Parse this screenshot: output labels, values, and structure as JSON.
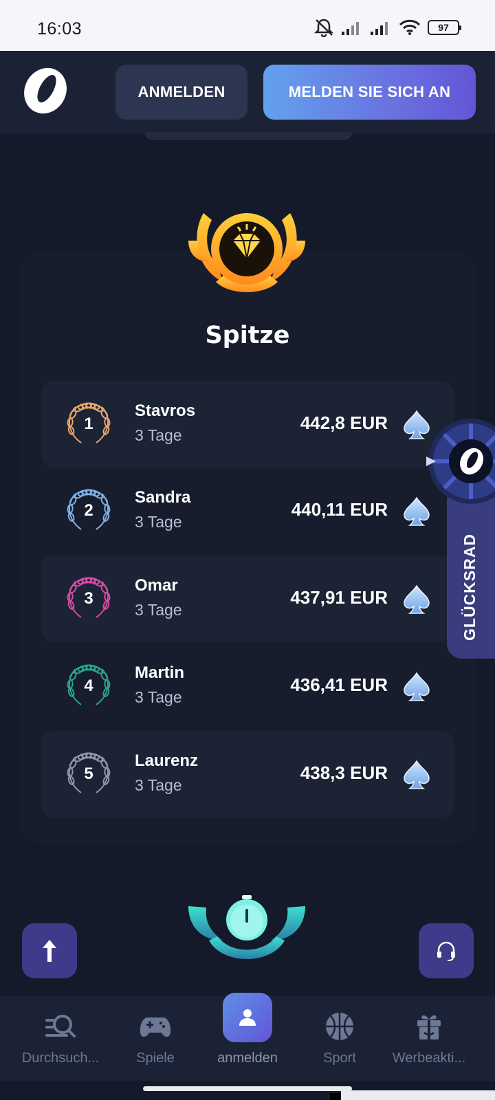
{
  "status_bar": {
    "time": "16:03",
    "battery": "97",
    "icons": [
      "mute-icon",
      "signal-icon",
      "signal-icon",
      "wifi-icon",
      "battery-icon"
    ]
  },
  "header": {
    "login_label": "ANMELDEN",
    "register_label": "MELDEN SIE SICH AN"
  },
  "leaderboard": {
    "title": "Spitze",
    "rows": [
      {
        "rank": "1",
        "name": "Stavros",
        "days": "3 Tage",
        "amount": "442,8 EUR",
        "wreath_color": "#e8a86a"
      },
      {
        "rank": "2",
        "name": "Sandra",
        "days": "3 Tage",
        "amount": "440,11 EUR",
        "wreath_color": "#7fb0e4"
      },
      {
        "rank": "3",
        "name": "Omar",
        "days": "3 Tage",
        "amount": "437,91 EUR",
        "wreath_color": "#d94aa8"
      },
      {
        "rank": "4",
        "name": "Martin",
        "days": "3 Tage",
        "amount": "436,41 EUR",
        "wreath_color": "#2aa58e"
      },
      {
        "rank": "5",
        "name": "Laurenz",
        "days": "3 Tage",
        "amount": "438,3 EUR",
        "wreath_color": "#9097a8"
      }
    ]
  },
  "wheel": {
    "label": "GLÜCKSRAD"
  },
  "bottom_nav": [
    {
      "label": "Durchsuch...",
      "icon": "search-icon"
    },
    {
      "label": "Spiele",
      "icon": "gamepad-icon"
    },
    {
      "label": "anmelden",
      "icon": "user-icon",
      "active": true
    },
    {
      "label": "Sport",
      "icon": "basketball-icon"
    },
    {
      "label": "Werbeakti...",
      "icon": "gift-icon"
    }
  ],
  "colors": {
    "background": "#141a29",
    "header": "#1b2235",
    "accent_gradient": [
      "#62a2ee",
      "#6156d6"
    ],
    "muted_text": "#6c7894"
  }
}
